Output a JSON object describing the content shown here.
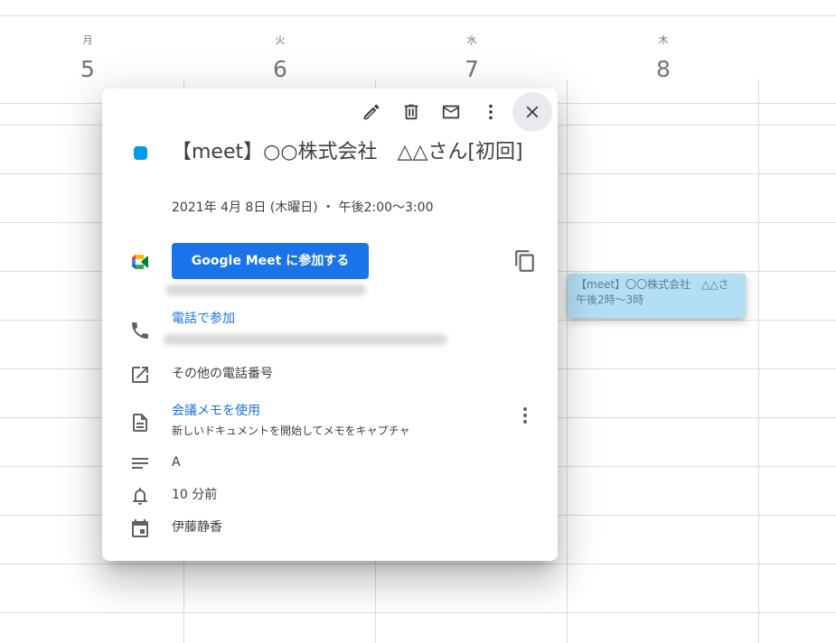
{
  "calendar": {
    "days": [
      {
        "dow": "月",
        "num": "5"
      },
      {
        "dow": "火",
        "num": "6"
      },
      {
        "dow": "水",
        "num": "7"
      },
      {
        "dow": "木",
        "num": "8"
      }
    ],
    "event_chip": {
      "title": "【meet】〇〇株式会社　△△さ",
      "time": "午後2時～3時",
      "color": "#b3dff5"
    }
  },
  "popover": {
    "toolbar": {
      "edit_icon": "pencil-icon",
      "delete_icon": "trash-icon",
      "email_icon": "mail-icon",
      "more_icon": "more-vert-icon",
      "close_icon": "close-icon"
    },
    "event_color": "#039be5",
    "title": "【meet】○○株式会社　△△さん[初回]",
    "datetime": "2021年 4月 8日 (木曜日)  ・  午後2:00～3:00",
    "meet": {
      "button_label": "Google Meet に参加する",
      "button_color": "#1a73e8"
    },
    "phone": {
      "link_label": "電話で参加"
    },
    "other_numbers": "その他の電話番号",
    "notes": {
      "link_label": "会議メモを使用",
      "description": "新しいドキュメントを開始してメモをキャプチャ"
    },
    "description": "A",
    "reminder": "10 分前",
    "organizer": "伊藤静香"
  }
}
